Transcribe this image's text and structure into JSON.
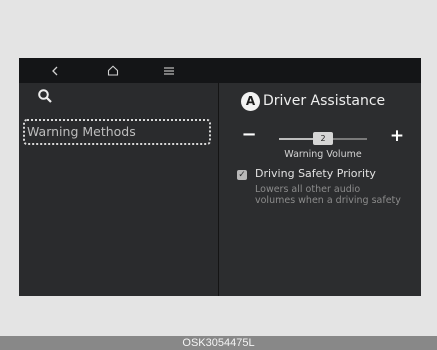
{
  "topbar": {
    "back_icon": "chevron-left-icon",
    "home_icon": "home-icon",
    "menu_icon": "hamburger-menu-icon"
  },
  "left_panel": {
    "search_icon": "search-icon",
    "menu_items": [
      {
        "label": "Warning Methods",
        "selected": true
      }
    ]
  },
  "right_panel": {
    "badge": "A",
    "title": "Driver Assistance",
    "volume": {
      "minus_label": "−",
      "plus_label": "+",
      "value": "2",
      "level_fraction": 0.5,
      "label": "Warning Volume"
    },
    "driving_safety_priority": {
      "checked": true,
      "label": "Driving Safety Priority",
      "description_line1": "Lowers all other audio",
      "description_line2": "volumes when a driving safety"
    }
  },
  "caption": "OSK3054475L",
  "colors": {
    "screen_bg": "#2c2d2f",
    "topbar_bg": "#141517",
    "page_bg": "#e4e4e4",
    "caption_bg": "#888888"
  }
}
